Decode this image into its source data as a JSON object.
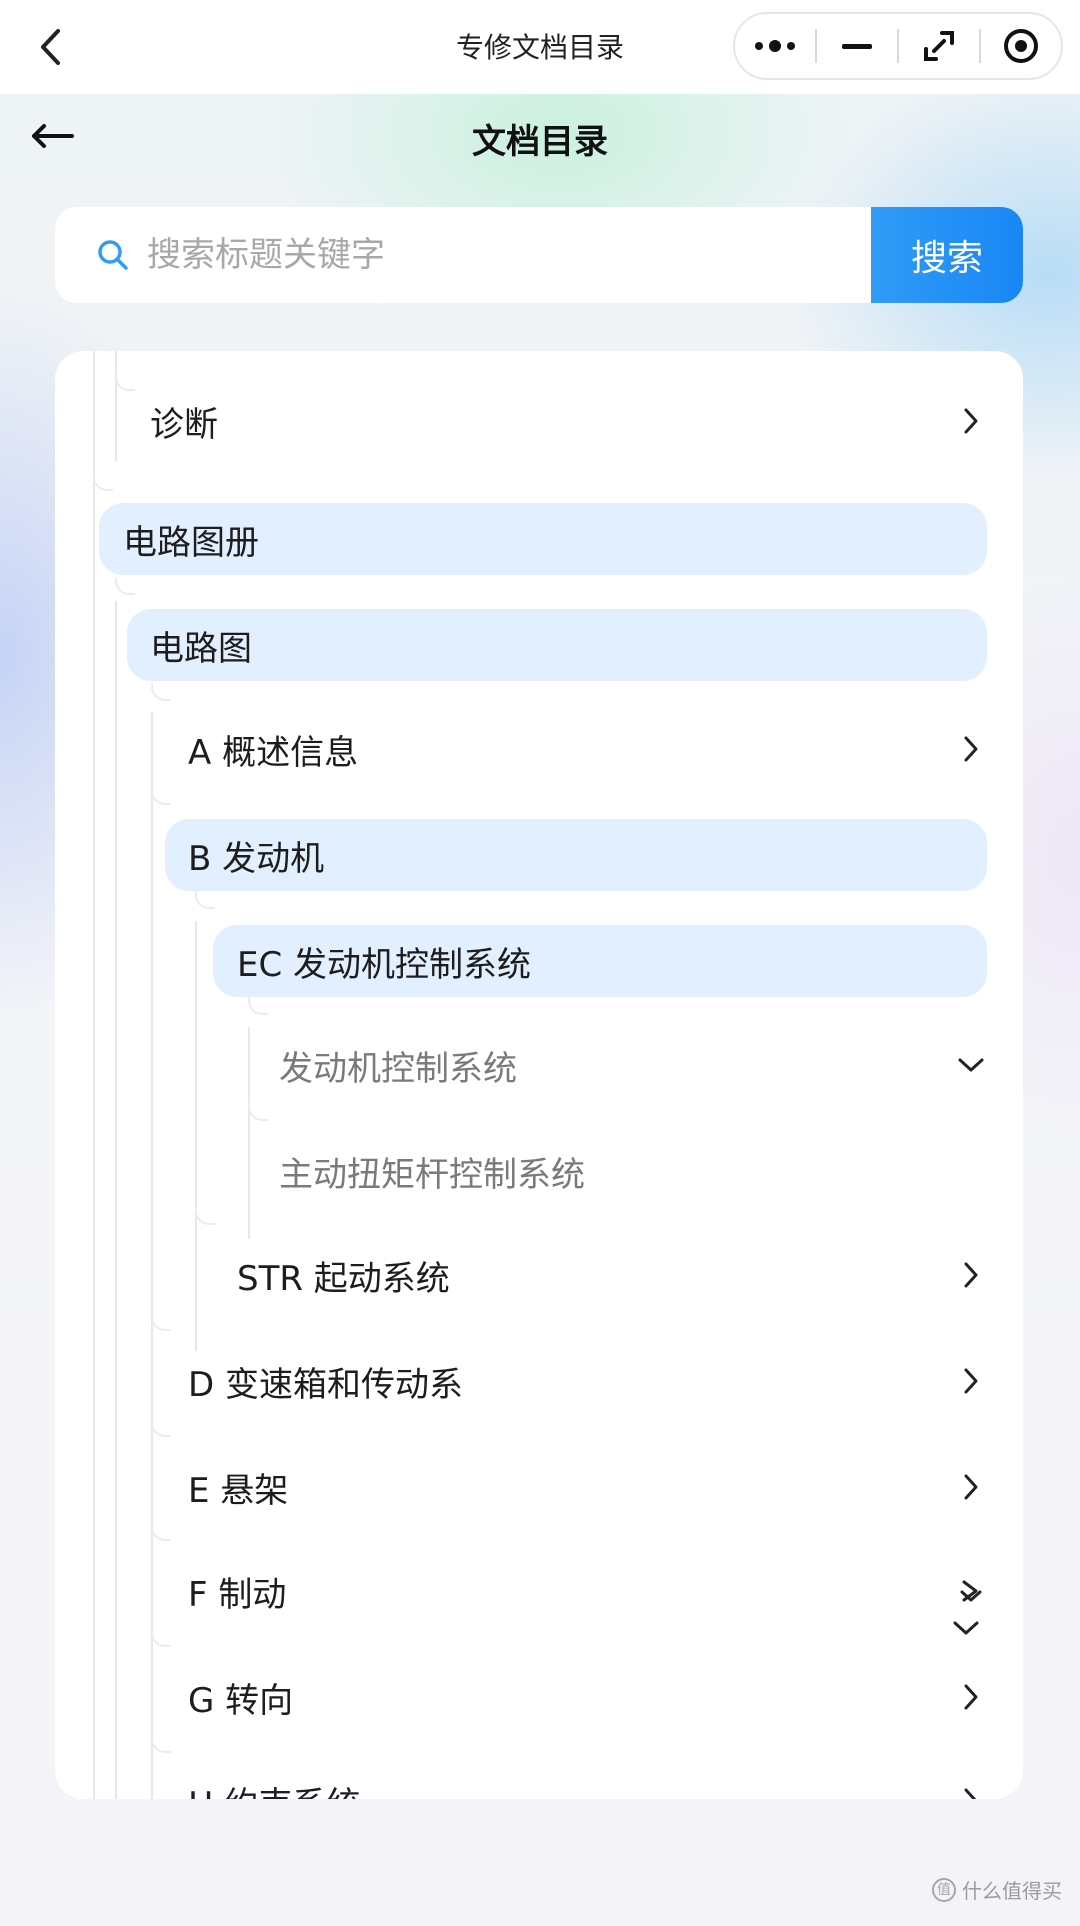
{
  "native_bar": {
    "title": "专修文档目录"
  },
  "page": {
    "title": "文档目录"
  },
  "search": {
    "placeholder": "搜索标题关键字",
    "button_label": "搜索"
  },
  "tree": {
    "items": [
      {
        "label": "诊断",
        "chevron": "right"
      },
      {
        "label": "电路图册",
        "highlighted": true
      },
      {
        "label": "电路图",
        "highlighted": true
      },
      {
        "label": "A 概述信息",
        "chevron": "right"
      },
      {
        "label": "B 发动机",
        "highlighted": true
      },
      {
        "label": "EC 发动机控制系统",
        "highlighted": true
      },
      {
        "label": "发动机控制系统",
        "chevron": "down"
      },
      {
        "label": "主动扭矩杆控制系统"
      },
      {
        "label": "STR 起动系统",
        "chevron": "right"
      },
      {
        "label": "D 变速箱和传动系",
        "chevron": "right"
      },
      {
        "label": "E 悬架",
        "chevron": "right"
      },
      {
        "label": "F 制动",
        "chevron": "right"
      },
      {
        "label": "G 转向",
        "chevron": "right"
      },
      {
        "label": "H 约束系统",
        "chevron": "right"
      }
    ]
  },
  "watermark": {
    "text": "什么值得买",
    "badge": "值"
  },
  "colors": {
    "accent": "#1a86f5",
    "highlight_bg": "#e2effe",
    "text_primary": "#1d1d1d",
    "text_secondary": "#7a7a7a"
  }
}
